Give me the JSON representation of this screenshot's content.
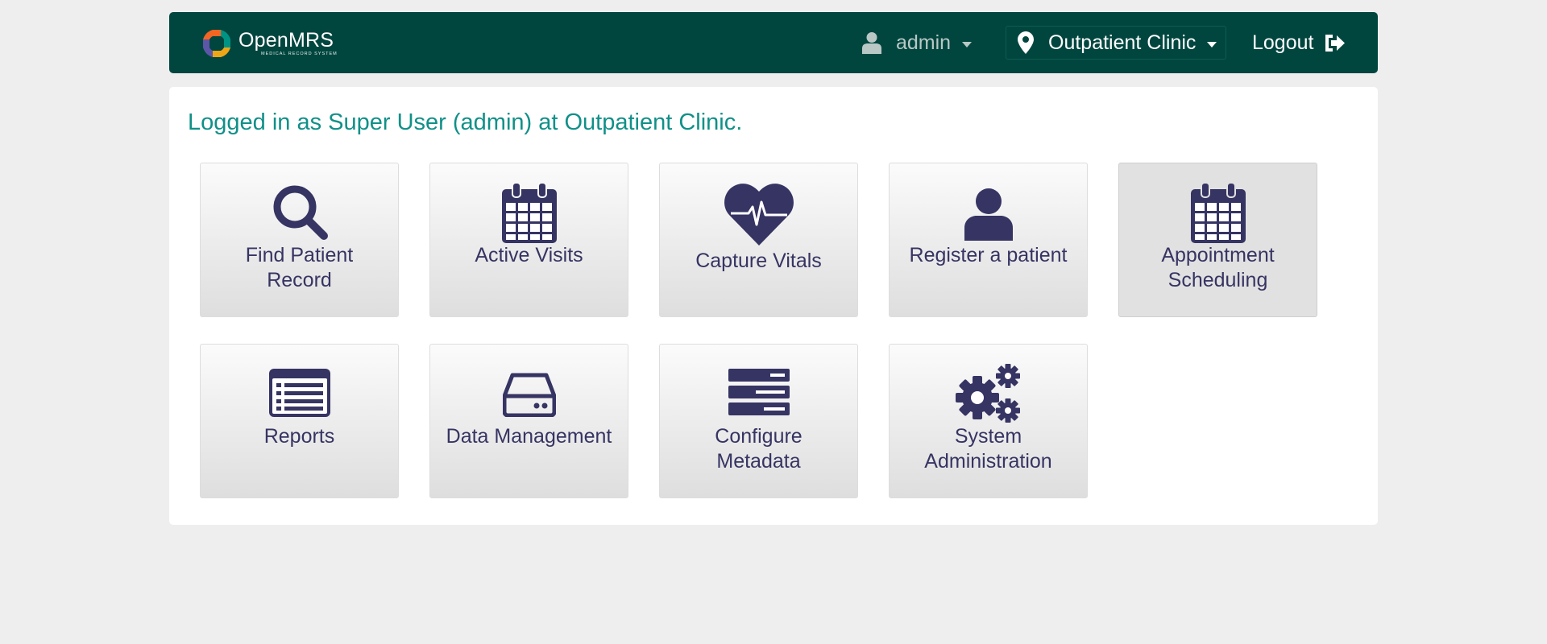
{
  "header": {
    "logo_name": "OpenMRS",
    "logo_subtitle": "MEDICAL RECORD SYSTEM",
    "user_label": "admin",
    "location_label": "Outpatient Clinic",
    "logout_label": "Logout"
  },
  "welcome_text": "Logged in as Super User (admin) at Outpatient Clinic.",
  "apps": [
    {
      "label": "Find Patient Record",
      "icon": "search-icon"
    },
    {
      "label": "Active Visits",
      "icon": "calendar-icon"
    },
    {
      "label": "Capture Vitals",
      "icon": "heartbeat-icon"
    },
    {
      "label": "Register a patient",
      "icon": "user-icon"
    },
    {
      "label": "Appointment Scheduling",
      "icon": "calendar-icon"
    },
    {
      "label": "Reports",
      "icon": "list-alt-icon"
    },
    {
      "label": "Data Management",
      "icon": "hdd-icon"
    },
    {
      "label": "Configure Metadata",
      "icon": "server-icon"
    },
    {
      "label": "System Administration",
      "icon": "cogs-icon"
    }
  ],
  "colors": {
    "header_bg": "#00463f",
    "welcome_text": "#109088",
    "icon_color": "#363463",
    "page_bg": "#eeeeee"
  }
}
